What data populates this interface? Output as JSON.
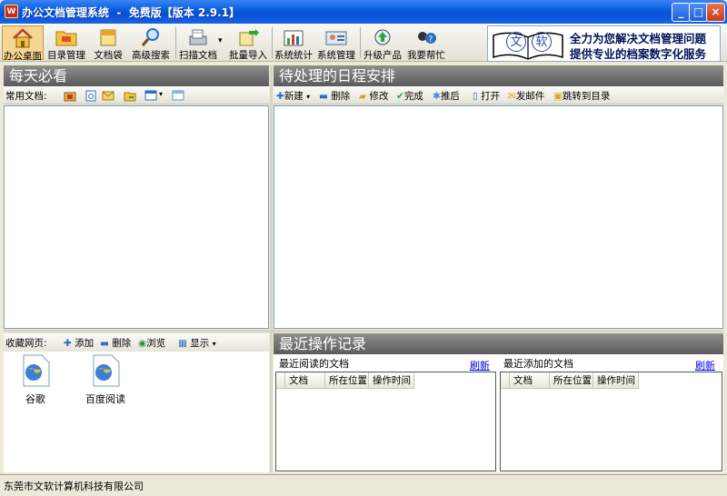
{
  "window": {
    "title": "办公文档管理系统  -  免费版【版本 2.9.1】",
    "app_icon_glyph": "W",
    "controls": {
      "minimize": "_",
      "maximize": "□",
      "close": "×"
    }
  },
  "toolbar": {
    "items": [
      {
        "label": "办公桌面",
        "icon": "home-icon",
        "active": true
      },
      {
        "label": "目录管理",
        "icon": "folder-tree-icon"
      },
      {
        "label": "文档袋",
        "icon": "document-bag-icon"
      },
      {
        "label": "高级搜索",
        "icon": "magnifier-icon"
      },
      {
        "label": "扫描文档",
        "icon": "scanner-icon"
      },
      {
        "label": "批量导入",
        "icon": "import-icon"
      },
      {
        "label": "系统统计",
        "icon": "bar-chart-icon"
      },
      {
        "label": "系统管理",
        "icon": "admin-icon"
      },
      {
        "label": "升级产品",
        "icon": "upgrade-icon"
      },
      {
        "label": "我要帮忙",
        "icon": "help-icon"
      }
    ],
    "scan_dropdown": "▾"
  },
  "banner": {
    "logo_text_1": "文",
    "logo_text_2": "软",
    "line1": "全力为您解决文档管理问题",
    "line2": "提供专业的档案数字化服务"
  },
  "left_top": {
    "title": "每天必看",
    "common_docs_label": "常用文档:"
  },
  "right_top": {
    "title": "待处理的日程安排",
    "toolbar": {
      "new": "新建",
      "delete": "删除",
      "edit": "修改",
      "complete": "完成",
      "postpone": "推后",
      "open": "打开",
      "send_mail": "发邮件",
      "goto_dir": "跳转到目录"
    }
  },
  "left_bottom": {
    "toolbar_label": "收藏网页:",
    "add": "添加",
    "delete": "删除",
    "browse": "浏览",
    "display": "显示",
    "favorites": [
      {
        "label": "谷歌"
      },
      {
        "label": "百度阅读"
      }
    ]
  },
  "right_bottom": {
    "title": "最近操作记录",
    "recent_read": {
      "title": "最近阅读的文档",
      "refresh": "刷新",
      "columns": [
        "文档",
        "所在位置",
        "操作时间"
      ]
    },
    "recent_added": {
      "title": "最近添加的文档",
      "refresh": "刷新",
      "columns": [
        "文档",
        "所在位置",
        "操作时间"
      ]
    }
  },
  "statusbar": {
    "company": "东莞市文软计算机科技有限公司"
  },
  "colors": {
    "titlebar": "#0a5fe0",
    "panel_header": "#6b6b6b",
    "accent_active": "#f6d692",
    "link": "#0000ee"
  }
}
